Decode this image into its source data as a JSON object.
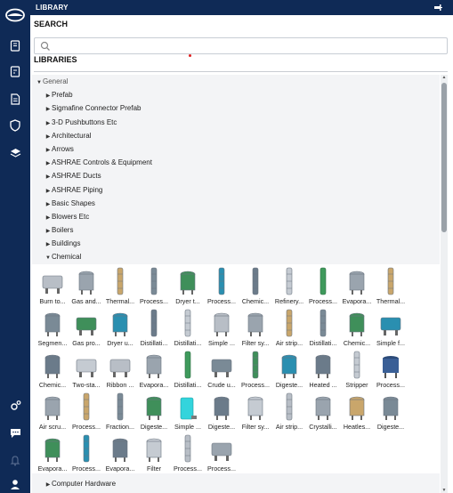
{
  "window": {
    "title": "LIBRARY"
  },
  "search": {
    "heading": "SEARCH",
    "placeholder": "",
    "value": "",
    "up_glyph": "↑"
  },
  "libraries": {
    "heading": "LIBRARIES",
    "root": {
      "label": "General",
      "expanded": true
    },
    "items": [
      "Prefab",
      "Sigmafine Connector Prefab",
      "3-D Pushbuttons Etc",
      "Architectural",
      "Arrows",
      "ASHRAE Controls & Equipment",
      "ASHRAE Ducts",
      "ASHRAE Piping",
      "Basic Shapes",
      "Blowers Etc",
      "Boilers",
      "Buildings"
    ],
    "expanded_item": {
      "label": "Chemical",
      "expanded": true
    },
    "after_item": {
      "label": "Computer Hardware"
    }
  },
  "chemical_symbols": [
    {
      "label": "Burn to...",
      "icon": "burner-icon"
    },
    {
      "label": "Gas and...",
      "icon": "gas-tank-icon"
    },
    {
      "label": "Thermal...",
      "icon": "thermal-column-icon"
    },
    {
      "label": "Process...",
      "icon": "process-tower-icon"
    },
    {
      "label": "Dryer t...",
      "icon": "dryer-icon"
    },
    {
      "label": "Process...",
      "icon": "process-column-icon"
    },
    {
      "label": "Chemic...",
      "icon": "chemical-column-icon"
    },
    {
      "label": "Refinery...",
      "icon": "refinery-column-icon"
    },
    {
      "label": "Process...",
      "icon": "process-column-green-icon"
    },
    {
      "label": "Evapora...",
      "icon": "evaporator-icon"
    },
    {
      "label": "Thermal...",
      "icon": "thermal-column-dark-icon"
    },
    {
      "label": "Segmen...",
      "icon": "segmented-tank-icon"
    },
    {
      "label": "Gas pro...",
      "icon": "gas-processor-icon"
    },
    {
      "label": "Dryer u...",
      "icon": "dryer-unit-icon"
    },
    {
      "label": "Distillati...",
      "icon": "distillation-icon"
    },
    {
      "label": "Distillati...",
      "icon": "distillation-2-icon"
    },
    {
      "label": "Simple ...",
      "icon": "simple-vessel-icon"
    },
    {
      "label": "Filter sy...",
      "icon": "filter-system-icon"
    },
    {
      "label": "Air strip...",
      "icon": "air-stripper-icon"
    },
    {
      "label": "Distillati...",
      "icon": "distillation-3-icon"
    },
    {
      "label": "Chemic...",
      "icon": "chemical-reactor-icon"
    },
    {
      "label": "Simple f...",
      "icon": "simple-flask-icon"
    },
    {
      "label": "Chemic...",
      "icon": "chemical-tank-icon"
    },
    {
      "label": "Two-sta...",
      "icon": "two-stage-icon"
    },
    {
      "label": "Ribbon ...",
      "icon": "ribbon-blender-icon"
    },
    {
      "label": "Evapora...",
      "icon": "evaporator-2-icon"
    },
    {
      "label": "Distillati...",
      "icon": "distillation-green-icon"
    },
    {
      "label": "Crude u...",
      "icon": "crude-unit-icon"
    },
    {
      "label": "Process...",
      "icon": "process-column-2-icon"
    },
    {
      "label": "Digeste...",
      "icon": "digester-icon"
    },
    {
      "label": "Heated ...",
      "icon": "heated-vessel-icon"
    },
    {
      "label": "Stripper",
      "icon": "stripper-icon"
    },
    {
      "label": "Process...",
      "icon": "process-vessel-blue-icon"
    },
    {
      "label": "Air scru...",
      "icon": "air-scrubber-icon"
    },
    {
      "label": "Process...",
      "icon": "process-column-3-icon"
    },
    {
      "label": "Fraction...",
      "icon": "fractionator-icon"
    },
    {
      "label": "Digeste...",
      "icon": "digester-2-icon"
    },
    {
      "label": "Simple ...",
      "icon": "simple-cyan-vessel-icon"
    },
    {
      "label": "Digeste...",
      "icon": "digester-3-icon"
    },
    {
      "label": "Filter sy...",
      "icon": "filter-system-2-icon"
    },
    {
      "label": "Air strip...",
      "icon": "air-stripper-2-icon"
    },
    {
      "label": "Crystalli...",
      "icon": "crystallizer-icon"
    },
    {
      "label": "Heatles...",
      "icon": "heatless-dryer-icon"
    },
    {
      "label": "Digeste...",
      "icon": "digester-4-icon"
    },
    {
      "label": "Evapora...",
      "icon": "evaporator-3-icon"
    },
    {
      "label": "Process...",
      "icon": "process-column-4-icon"
    },
    {
      "label": "Evapora...",
      "icon": "evaporator-4-icon"
    },
    {
      "label": "Filter",
      "icon": "filter-icon"
    },
    {
      "label": "Process...",
      "icon": "process-tower-2-icon"
    },
    {
      "label": "Process...",
      "icon": "process-funnel-icon"
    }
  ],
  "colors": {
    "rail": "#0f2a56",
    "accent_red": "#e02020",
    "tree_bg": "#f3f4f6"
  }
}
